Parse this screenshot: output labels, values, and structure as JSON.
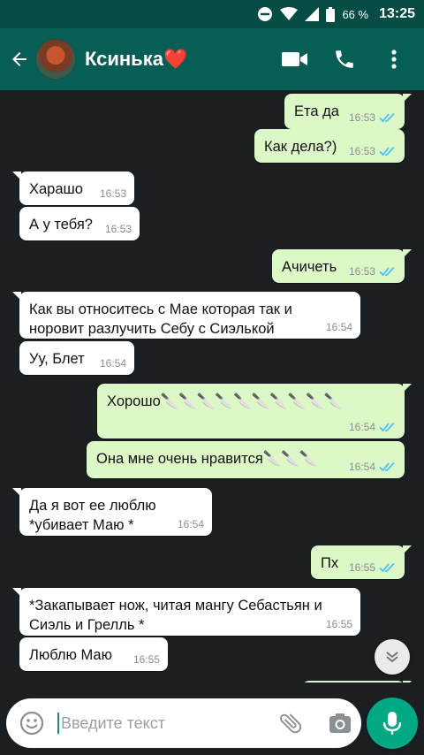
{
  "status_bar": {
    "battery_percent": "66 %",
    "time": "13:25",
    "icons": [
      "do-not-disturb-icon",
      "wifi-icon",
      "signal-icon",
      "battery-icon"
    ]
  },
  "header": {
    "contact_name": "Ксинька❤️",
    "icons": [
      "back-arrow-icon",
      "video-call-icon",
      "phone-icon",
      "more-vert-icon"
    ],
    "accent_color": "#075e54"
  },
  "messages": [
    {
      "dir": "out",
      "text": "Ета да",
      "time": "16:53"
    },
    {
      "dir": "out",
      "text": "Как дела?)",
      "time": "16:53"
    },
    {
      "dir": "in",
      "text": "Харашо",
      "time": "16:53"
    },
    {
      "dir": "in",
      "text": "А у тебя?",
      "time": "16:53"
    },
    {
      "dir": "out",
      "text": "Ачичеть",
      "time": "16:53"
    },
    {
      "dir": "in",
      "text_line1": "Как вы относитесь с Мае которая так и",
      "text_line2": "норовит разлучить Себу с Сиэлькой",
      "time": "16:54"
    },
    {
      "dir": "in",
      "text": "Уу, Блет",
      "time": "16:54"
    },
    {
      "dir": "out",
      "text": "Хорошо🔪🔪🔪🔪🔪🔪🔪🔪🔪🔪",
      "time": "16:54"
    },
    {
      "dir": "out",
      "text": "Она мне очень нравится🔪🔪🔪",
      "time": "16:54"
    },
    {
      "dir": "in",
      "text_line1": "Да я вот ее люблю",
      "text_line2": "*убивает Маю *",
      "time": "16:54"
    },
    {
      "dir": "out",
      "text": "Пх",
      "time": "16:55"
    },
    {
      "dir": "in",
      "text_line1": "*Закапывает нож, читая мангу Себастьян и",
      "text_line2": "Сиэль и Грелль *",
      "time": "16:55"
    },
    {
      "dir": "in",
      "text": "Люблю Маю",
      "time": "16:55"
    }
  ],
  "input": {
    "placeholder": "Введите текст",
    "value": ""
  },
  "colors": {
    "outgoing_bubble": "#dcf8c6",
    "incoming_bubble": "#ffffff",
    "read_ticks": "#4fc3f7",
    "mic_button": "#00a884"
  }
}
